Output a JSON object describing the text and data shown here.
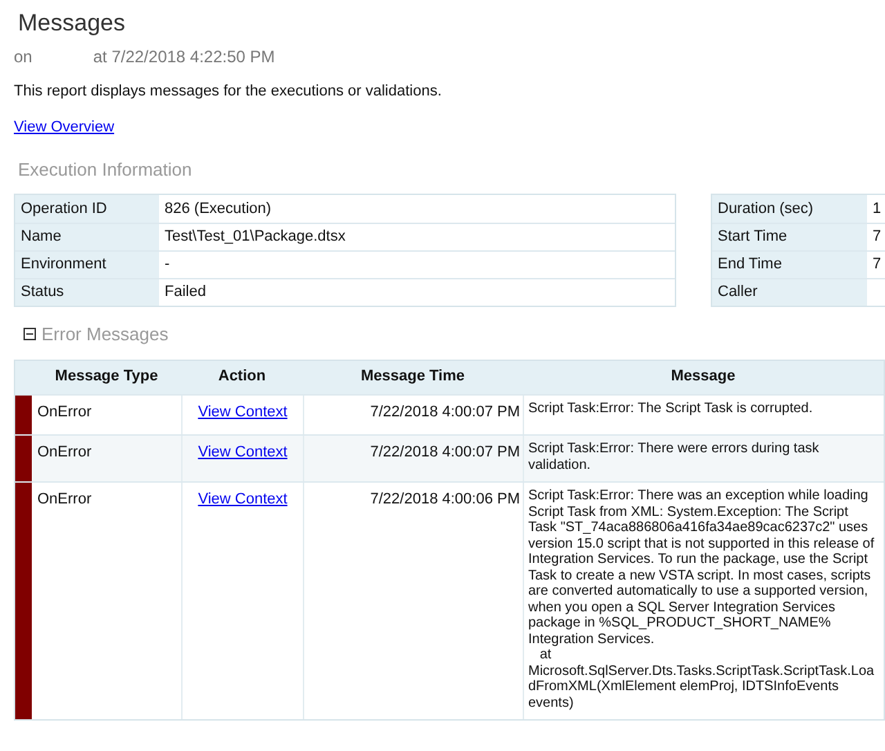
{
  "title": "Messages",
  "subtitle": {
    "on": "on",
    "at": "at 7/22/2018 4:22:50 PM"
  },
  "description": "This report displays messages for the executions or validations.",
  "overview_link": "View Overview",
  "execution_information": {
    "heading": "Execution Information",
    "left": [
      {
        "label": "Operation ID",
        "value": "826 (Execution)"
      },
      {
        "label": "Name",
        "value": "Test\\Test_01\\Package.dtsx"
      },
      {
        "label": "Environment",
        "value": "-"
      },
      {
        "label": "Status",
        "value": "Failed"
      }
    ],
    "right": [
      {
        "label": "Duration (sec)",
        "value": "1"
      },
      {
        "label": "Start Time",
        "value": "7"
      },
      {
        "label": "End Time",
        "value": "7"
      },
      {
        "label": "Caller"
      }
    ]
  },
  "error_messages": {
    "heading": "Error Messages",
    "expanded": true,
    "columns": [
      "Message Type",
      "Action",
      "Message Time",
      "Message"
    ],
    "rows": [
      {
        "color": "#800000",
        "type": "OnError",
        "action": "View Context",
        "time": "7/22/2018 4:00:07 PM",
        "message": "Script Task:Error: The Script Task is corrupted."
      },
      {
        "color": "#800000",
        "type": "OnError",
        "action": "View Context",
        "time": "7/22/2018 4:00:07 PM",
        "message": "Script Task:Error: There were errors during task validation."
      },
      {
        "color": "#800000",
        "type": "OnError",
        "action": "View Context",
        "time": "7/22/2018 4:00:06 PM",
        "message": "Script Task:Error: There was an exception while loading Script Task from XML: System.Exception: The Script Task \"ST_74aca886806a416fa34ae89cac6237c2\" uses version 15.0 script that is not supported in this release of Integration Services. To run the package, use the Script Task to create a new VSTA script. In most cases, scripts are converted automatically to use a supported version, when you open a SQL Server Integration Services package in %SQL_PRODUCT_SHORT_NAME% Integration Services.\n   at\nMicrosoft.SqlServer.Dts.Tasks.ScriptTask.ScriptTask.LoadFromXML(XmlElement elemProj, IDTSInfoEvents events)"
      }
    ]
  }
}
